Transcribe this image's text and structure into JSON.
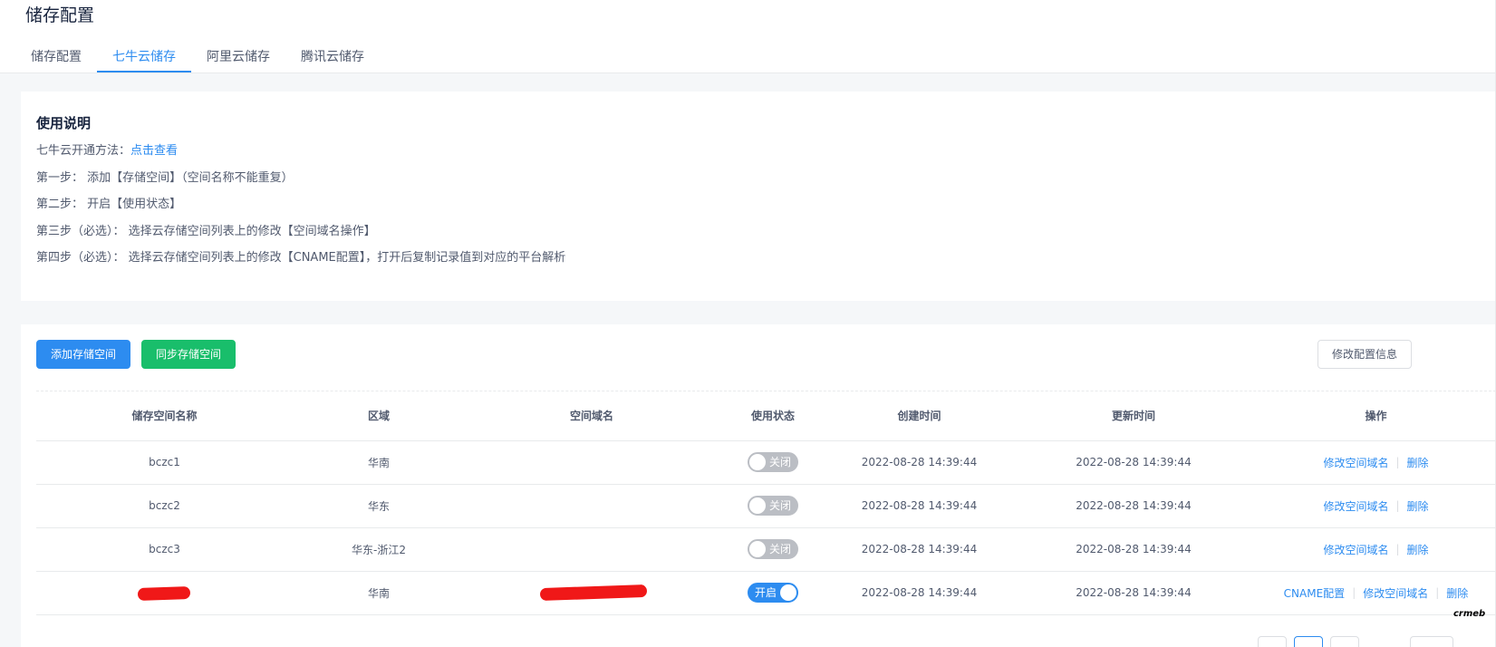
{
  "page": {
    "title": "储存配置"
  },
  "tabs": [
    {
      "label": "储存配置",
      "active": false
    },
    {
      "label": "七牛云储存",
      "active": true
    },
    {
      "label": "阿里云储存",
      "active": false
    },
    {
      "label": "腾讯云储存",
      "active": false
    }
  ],
  "instructions": {
    "title": "使用说明",
    "line1_prefix": "七牛云开通方法：",
    "line1_link": "点击查看",
    "step1": "第一步： 添加【存储空间】（空间名称不能重复）",
    "step2": "第二步： 开启【使用状态】",
    "step3": "第三步（必选）： 选择云存储空间列表上的修改【空间域名操作】",
    "step4": "第四步（必选）： 选择云存储空间列表上的修改【CNAME配置】，打开后复制记录值到对应的平台解析"
  },
  "toolbar": {
    "add_label": "添加存储空间",
    "sync_label": "同步存储空间",
    "edit_config_label": "修改配置信息"
  },
  "table": {
    "columns": [
      "储存空间名称",
      "区域",
      "空间域名",
      "使用状态",
      "创建时间",
      "更新时间",
      "操作"
    ],
    "rows": [
      {
        "name": "bczc1",
        "region": "华南",
        "domain": "",
        "status": "关闭",
        "status_on": false,
        "created": "2022-08-28 14:39:44",
        "updated": "2022-08-28 14:39:44",
        "actions": [
          "修改空间域名",
          "删除"
        ]
      },
      {
        "name": "bczc2",
        "region": "华东",
        "domain": "",
        "status": "关闭",
        "status_on": false,
        "created": "2022-08-28 14:39:44",
        "updated": "2022-08-28 14:39:44",
        "actions": [
          "修改空间域名",
          "删除"
        ]
      },
      {
        "name": "bczc3",
        "region": "华东-浙江2",
        "domain": "",
        "status": "关闭",
        "status_on": false,
        "created": "2022-08-28 14:39:44",
        "updated": "2022-08-28 14:39:44",
        "actions": [
          "修改空间域名",
          "删除"
        ]
      },
      {
        "name": "",
        "region": "华南",
        "domain": "",
        "status": "开启",
        "status_on": true,
        "created": "2022-08-28 14:39:44",
        "updated": "2022-08-28 14:39:44",
        "actions": [
          "CNAME配置",
          "修改空间域名",
          "删除"
        ]
      }
    ]
  },
  "branding": {
    "logo_text": "crmeb"
  },
  "colors": {
    "primary": "#2d8cf0",
    "success": "#19be6b",
    "switch_off": "#bbbec4",
    "redaction": "#f01818"
  }
}
